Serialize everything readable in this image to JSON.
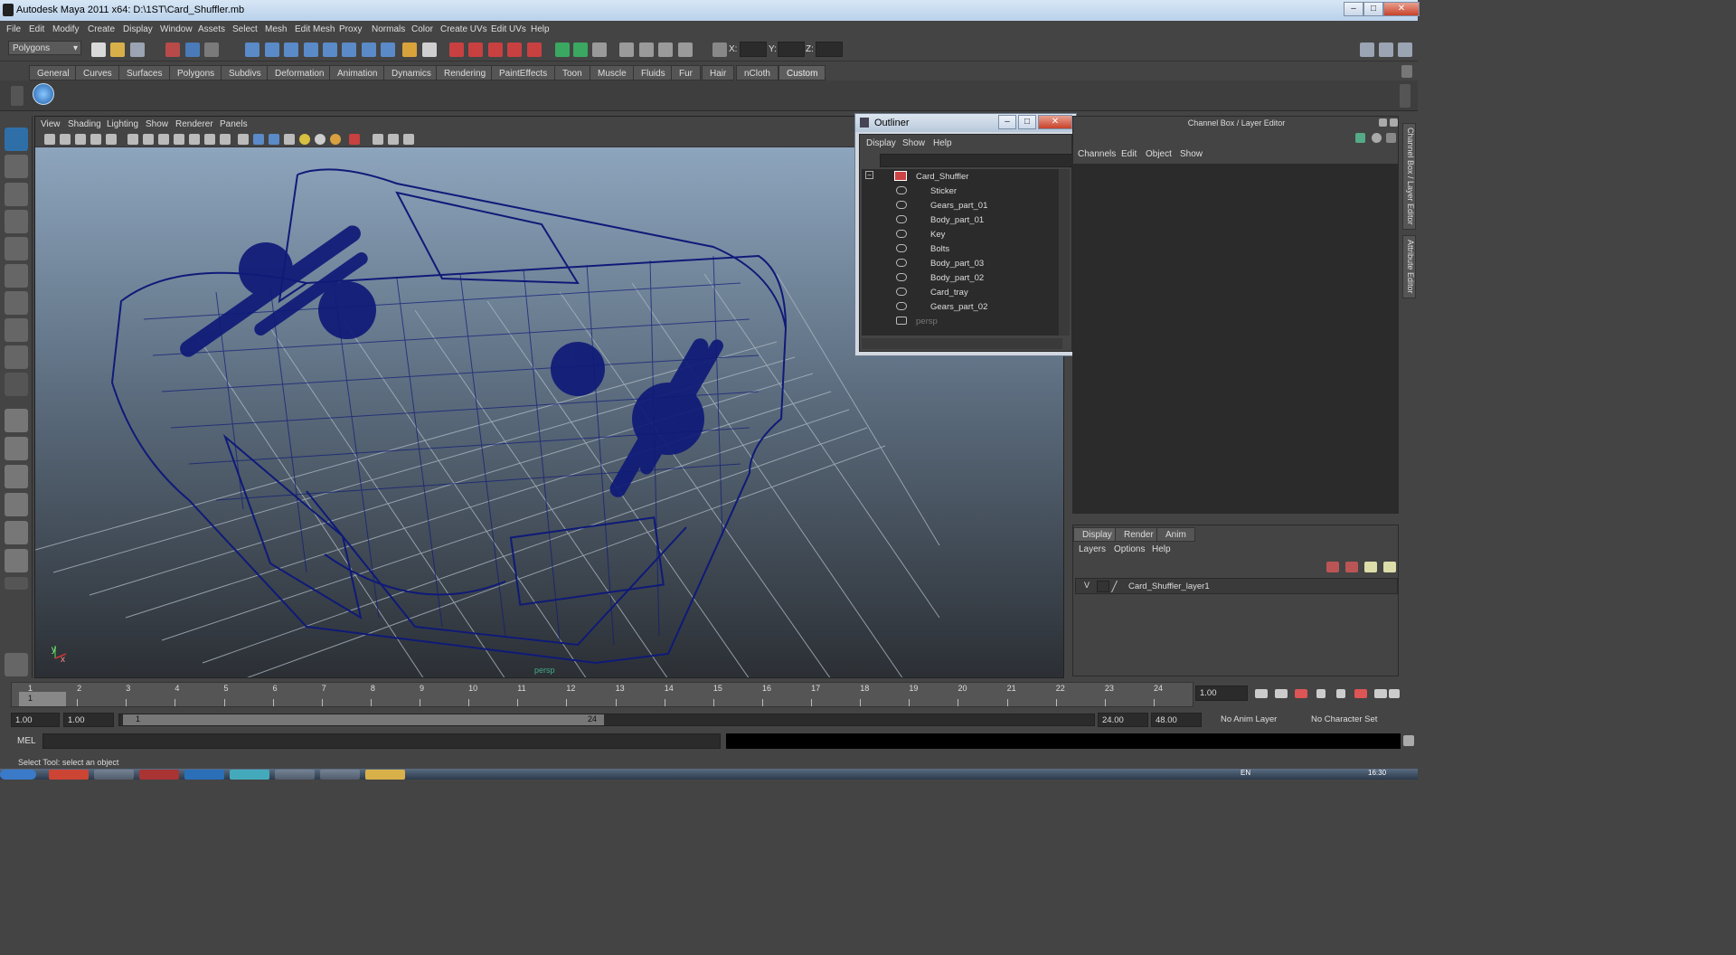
{
  "window": {
    "title": "Autodesk Maya 2011 x64: D:\\1ST\\Card_Shuffler.mb",
    "buttons": [
      "–",
      "□",
      "✕"
    ]
  },
  "menubar": {
    "items": [
      "File",
      "Edit",
      "Modify",
      "Create",
      "Display",
      "Window",
      "Assets",
      "Select",
      "Mesh",
      "Edit Mesh",
      "Proxy",
      "Normals",
      "Color",
      "Create UVs",
      "Edit UVs",
      "Help"
    ]
  },
  "statusline": {
    "mode": "Polygons",
    "coords": {
      "x_label": "X:",
      "y_label": "Y:",
      "z_label": "Z:"
    }
  },
  "shelf": {
    "tabs": [
      "General",
      "Curves",
      "Surfaces",
      "Polygons",
      "Subdivs",
      "Deformation",
      "Animation",
      "Dynamics",
      "Rendering",
      "PaintEffects",
      "Toon",
      "Muscle",
      "Fluids",
      "Fur",
      "Hair",
      "nCloth",
      "Custom"
    ],
    "active_tab": "Custom"
  },
  "viewport": {
    "menu": [
      "View",
      "Shading",
      "Lighting",
      "Show",
      "Renderer",
      "Panels"
    ],
    "camera_label": "persp",
    "axis": {
      "x": "x",
      "y": "y"
    }
  },
  "outliner": {
    "title": "Outliner",
    "menu": [
      "Display",
      "Show",
      "Help"
    ],
    "root": "Card_Shuffler",
    "children": [
      "Sticker",
      "Gears_part_01",
      "Body_part_01",
      "Key",
      "Bolts",
      "Body_part_03",
      "Body_part_02",
      "Card_tray",
      "Gears_part_02"
    ],
    "camera": "persp",
    "collapse_symbol": "−"
  },
  "channelbox": {
    "title": "Channel Box / Layer Editor",
    "menu": [
      "Channels",
      "Edit",
      "Object",
      "Show"
    ]
  },
  "sidetabs": [
    "Channel Box / Layer Editor",
    "Attribute Editor"
  ],
  "layereditor": {
    "tabs": [
      "Display",
      "Render",
      "Anim"
    ],
    "active_tab": "Display",
    "menu": [
      "Layers",
      "Options",
      "Help"
    ],
    "layer": {
      "visible": "V",
      "name": "Card_Shuffler_layer1"
    }
  },
  "timeslider": {
    "ticks": [
      "1",
      "2",
      "3",
      "4",
      "5",
      "6",
      "7",
      "8",
      "9",
      "10",
      "11",
      "12",
      "13",
      "14",
      "15",
      "16",
      "17",
      "18",
      "19",
      "20",
      "21",
      "22",
      "23",
      "24"
    ],
    "current_frame": "1",
    "current_time": "1.00"
  },
  "range": {
    "start_time": "1.00",
    "playback_start": "1.00",
    "range_start": "1",
    "range_end": "24",
    "playback_end": "24.00",
    "end_time": "48.00",
    "anim_layer": "No Anim Layer",
    "char_set": "No Character Set"
  },
  "cmdline": {
    "label": "MEL"
  },
  "helpline": {
    "text": "Select Tool: select an object"
  },
  "taskbar": {
    "clock": "16:30",
    "lang": "EN"
  },
  "colors": {
    "wireframe": "#0f1a78",
    "grid": "#9aa7b3",
    "accent": "#5e5e5e"
  }
}
